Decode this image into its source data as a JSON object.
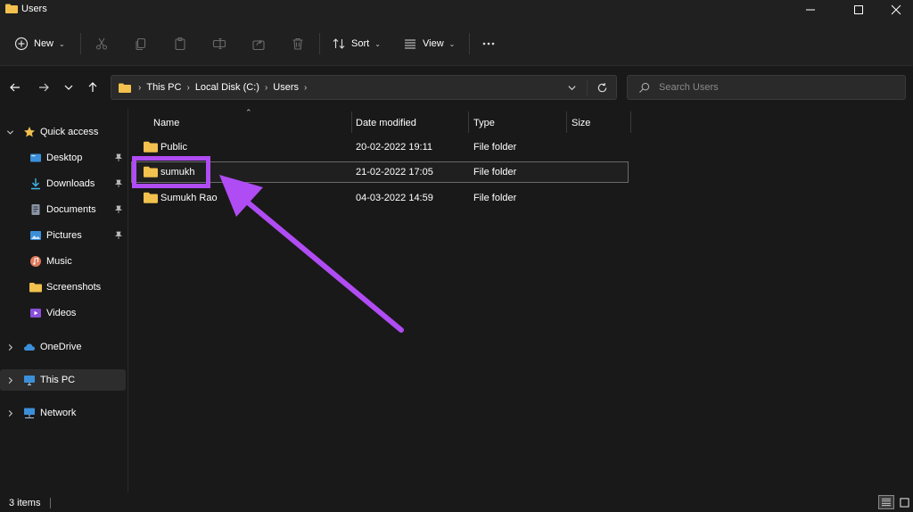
{
  "window": {
    "title": "Users"
  },
  "commandbar": {
    "new_label": "New",
    "sort_label": "Sort",
    "view_label": "View"
  },
  "address": {
    "segments": [
      "This PC",
      "Local Disk (C:)",
      "Users"
    ]
  },
  "search": {
    "placeholder": "Search Users"
  },
  "sidebar": {
    "quick_access": "Quick access",
    "items": [
      {
        "label": "Desktop",
        "icon": "desktop-icon",
        "pinned": true
      },
      {
        "label": "Downloads",
        "icon": "download-icon",
        "pinned": true
      },
      {
        "label": "Documents",
        "icon": "document-icon",
        "pinned": true
      },
      {
        "label": "Pictures",
        "icon": "picture-icon",
        "pinned": true
      },
      {
        "label": "Music",
        "icon": "music-icon",
        "pinned": false
      },
      {
        "label": "Screenshots",
        "icon": "folder-icon",
        "pinned": false
      },
      {
        "label": "Videos",
        "icon": "video-icon",
        "pinned": false
      }
    ],
    "onedrive": "OneDrive",
    "this_pc": "This PC",
    "network": "Network"
  },
  "columns": {
    "name": "Name",
    "date": "Date modified",
    "type": "Type",
    "size": "Size"
  },
  "files": [
    {
      "name": "Public",
      "date": "20-02-2022 19:11",
      "type": "File folder"
    },
    {
      "name": "sumukh",
      "date": "21-02-2022 17:05",
      "type": "File folder"
    },
    {
      "name": "Sumukh Rao",
      "date": "04-03-2022 14:59",
      "type": "File folder"
    }
  ],
  "status": {
    "count": "3 items"
  },
  "colors": {
    "accent_annotation": "#b04cf3",
    "folder": "#f2c14e",
    "background": "#191919"
  }
}
